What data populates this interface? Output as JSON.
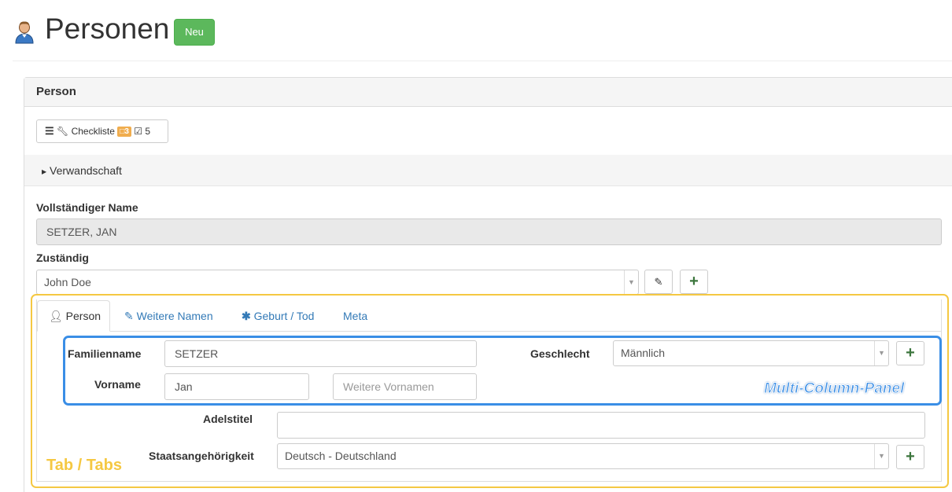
{
  "header": {
    "title": "Personen",
    "new_button": "Neu"
  },
  "panel": {
    "title": "Person",
    "checklist": {
      "label": "Checkliste",
      "badge": "3",
      "done_count": "5"
    },
    "accordion": "Verwandschaft",
    "full_name": {
      "label": "Vollständiger Name",
      "value": "SETZER, JAN"
    },
    "responsible": {
      "label": "Zuständig",
      "value": "John Doe"
    }
  },
  "tabs": [
    {
      "label": "Person",
      "icon": "user-icon",
      "active": true
    },
    {
      "label": "Weitere Namen",
      "icon": "pencil-icon",
      "active": false
    },
    {
      "label": "Geburt / Tod",
      "icon": "asterisk-icon",
      "active": false
    },
    {
      "label": "Meta",
      "icon": "",
      "active": false
    }
  ],
  "form": {
    "family_name": {
      "label": "Familienname",
      "value": "SETZER"
    },
    "first_name": {
      "label": "Vorname",
      "value": "Jan"
    },
    "more_first_names": {
      "placeholder": "Weitere Vornamen"
    },
    "gender": {
      "label": "Geschlecht",
      "value": "Männlich"
    },
    "noble_title": {
      "label": "Adelstitel",
      "value": ""
    },
    "nationality": {
      "label": "Staatsangehörigkeit",
      "value": "Deutsch - Deutschland"
    }
  },
  "annotations": {
    "multi_column": "Multi-Column-Panel",
    "tabs": "Tab / Tabs"
  },
  "colors": {
    "success": "#5cb85c",
    "warning": "#f0ad4e",
    "link": "#337ab7",
    "note_blue": "#3a8ee6",
    "note_yellow": "#f5c842"
  }
}
